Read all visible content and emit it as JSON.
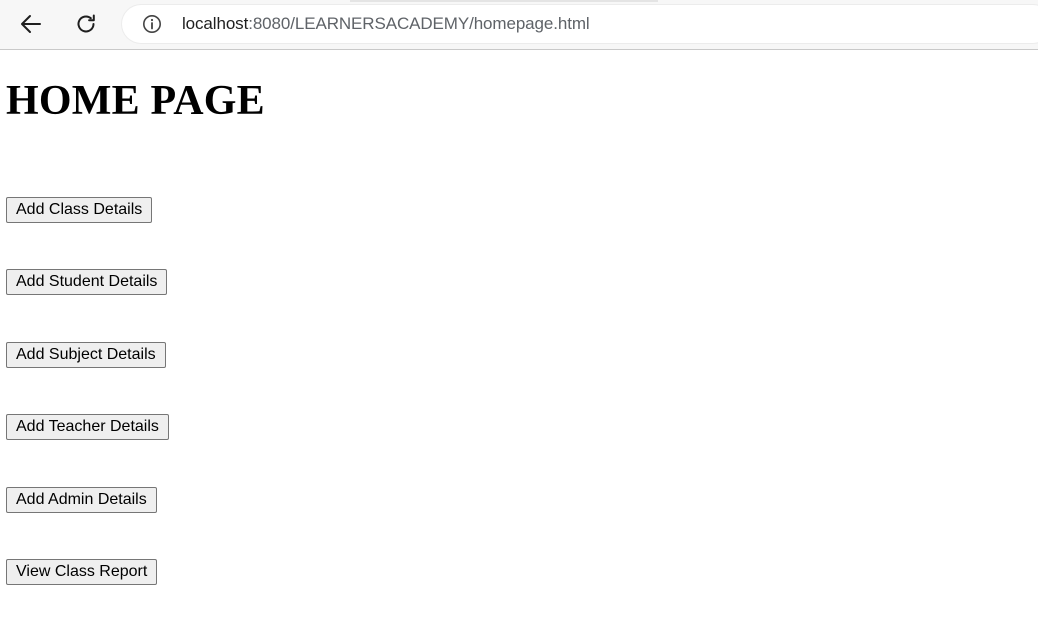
{
  "browser": {
    "url_host": "localhost",
    "url_rest": ":8080/LEARNERSACADEMY/homepage.html",
    "back_icon": "arrow-left-icon",
    "reload_icon": "reload-icon",
    "info_icon": "info-icon"
  },
  "page": {
    "title": "HOME PAGE",
    "buttons": [
      {
        "label": "Add Class Details"
      },
      {
        "label": "Add Student Details"
      },
      {
        "label": "Add Subject Details"
      },
      {
        "label": "Add Teacher Details"
      },
      {
        "label": "Add Admin Details"
      },
      {
        "label": "View Class Report"
      }
    ]
  }
}
